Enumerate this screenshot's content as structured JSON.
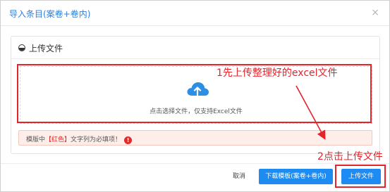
{
  "dialog": {
    "title": "导入条目(案卷+卷内)",
    "close_glyph": "×"
  },
  "panel": {
    "title": "上传文件"
  },
  "dropzone": {
    "text": "点击选择文件，仅支持Excel文件"
  },
  "warning": {
    "prefix": "模版中",
    "highlight": "【红色】",
    "suffix": "文字列为必填项！",
    "icon_glyph": "!"
  },
  "footer": {
    "cancel_label": "取消",
    "download_label": "下载模板(案卷+卷内)",
    "upload_label": "上传文件"
  },
  "annotations": {
    "step1": "1先上传整理好的excel文件",
    "step2": "2点击上传文件"
  },
  "colors": {
    "accent": "#1e8bf2",
    "annotation": "#e4232a",
    "title": "#2f7fd8"
  }
}
